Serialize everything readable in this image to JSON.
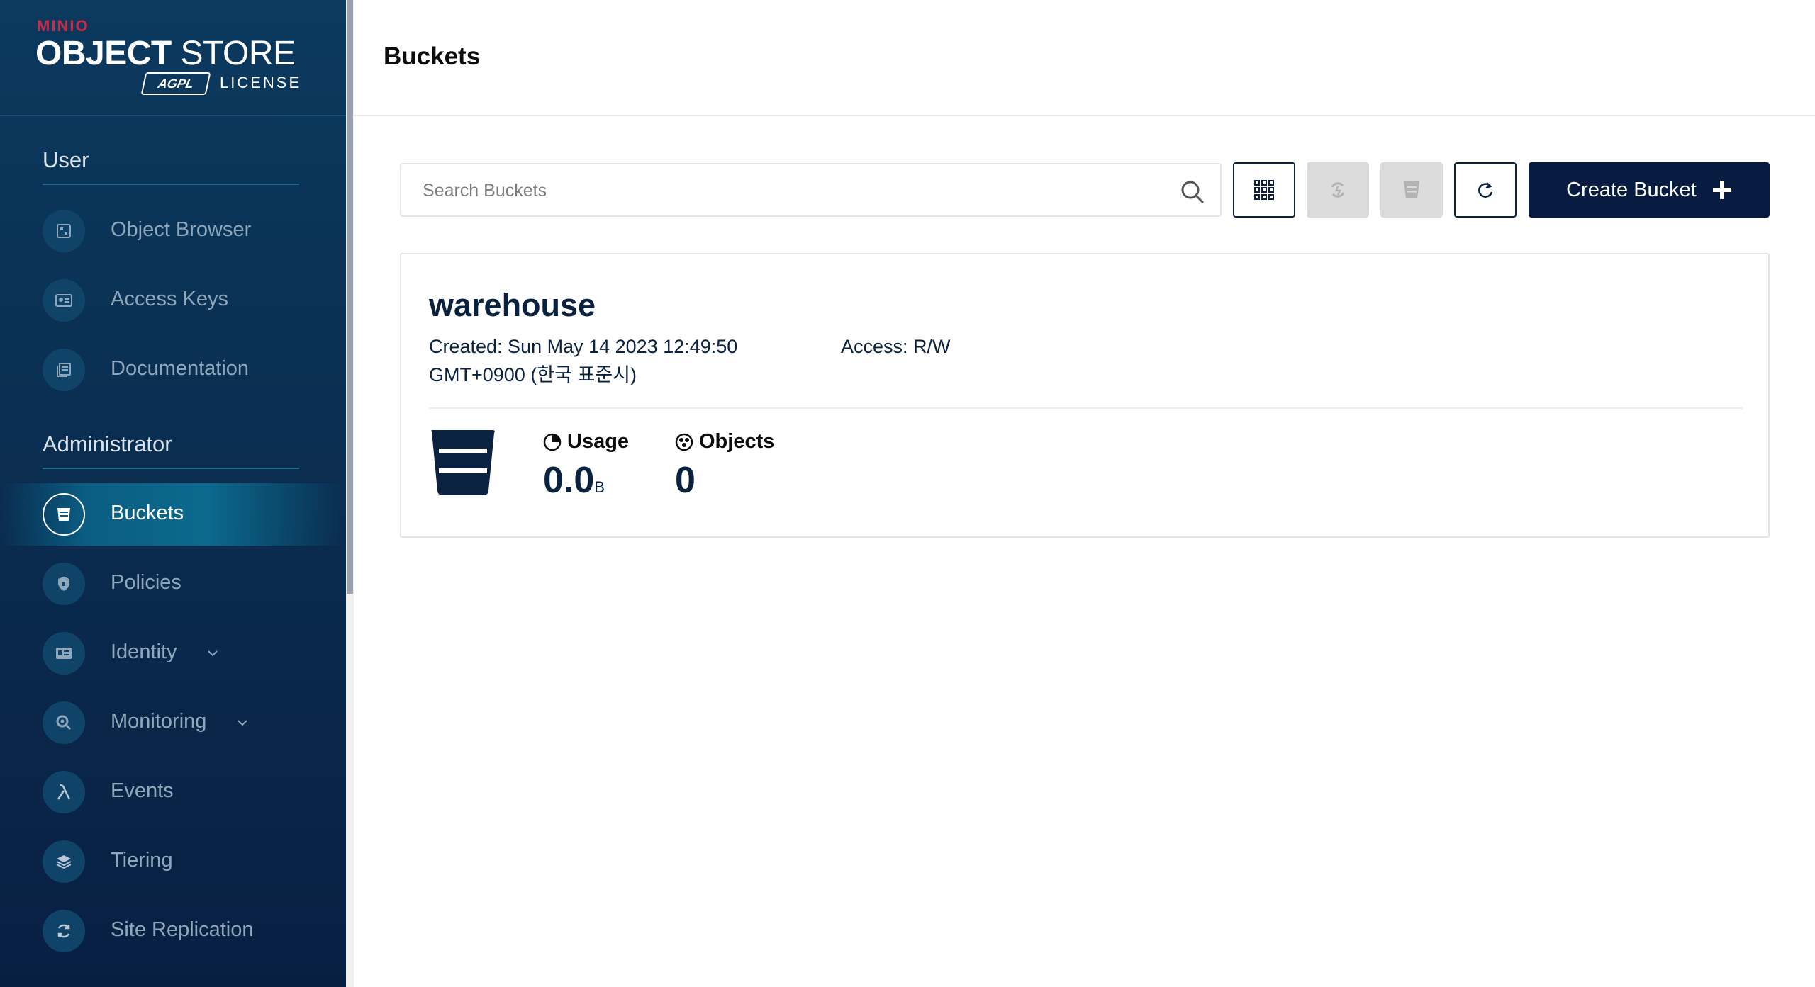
{
  "brand": {
    "minio": "MINIO",
    "product_bold": "OBJECT",
    "product_rest": " STORE",
    "badge": "AGPL",
    "license": "LICENSE",
    "accent": "#c72c48"
  },
  "sidebar": {
    "user_section": "User",
    "admin_section": "Administrator",
    "user_items": [
      {
        "label": "Object Browser",
        "icon": "object-browser-icon"
      },
      {
        "label": "Access Keys",
        "icon": "access-keys-icon"
      },
      {
        "label": "Documentation",
        "icon": "documentation-icon"
      }
    ],
    "admin_items": [
      {
        "label": "Buckets",
        "icon": "bucket-icon",
        "active": true
      },
      {
        "label": "Policies",
        "icon": "shield-icon"
      },
      {
        "label": "Identity",
        "icon": "identity-card-icon",
        "expandable": true
      },
      {
        "label": "Monitoring",
        "icon": "monitoring-icon",
        "expandable": true
      },
      {
        "label": "Events",
        "icon": "lambda-icon"
      },
      {
        "label": "Tiering",
        "icon": "layers-icon"
      },
      {
        "label": "Site Replication",
        "icon": "replication-icon"
      }
    ]
  },
  "header": {
    "title": "Buckets"
  },
  "toolbar": {
    "search_placeholder": "Search Buckets",
    "create_label": "Create Bucket"
  },
  "bucket": {
    "name": "warehouse",
    "created": "Created: Sun May 14 2023 12:49:50 GMT+0900 (한국 표준시)",
    "access": "Access: R/W",
    "usage_label": "Usage",
    "usage_value": "0.0",
    "usage_unit": "B",
    "objects_label": "Objects",
    "objects_value": "0"
  },
  "colors": {
    "sidebar_bg": "#0a2f52",
    "primary": "#081c42"
  }
}
